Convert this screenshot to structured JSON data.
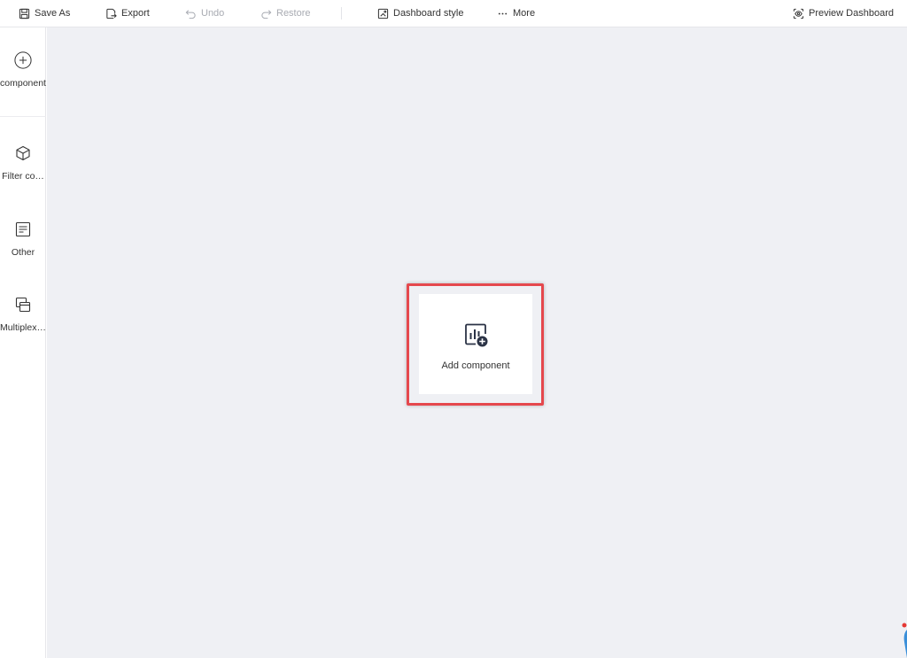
{
  "toolbar": {
    "save_as": "Save As",
    "export": "Export",
    "undo": "Undo",
    "restore": "Restore",
    "dashboard_style": "Dashboard style",
    "more": "More",
    "preview": "Preview Dashboard"
  },
  "sidebar": {
    "items": [
      {
        "label": "component",
        "icon": "plus-circle-icon"
      },
      {
        "label": "Filter co…",
        "icon": "cube-icon"
      },
      {
        "label": "Other",
        "icon": "text-box-icon"
      },
      {
        "label": "Multiplex…",
        "icon": "stacked-windows-icon"
      }
    ]
  },
  "canvas": {
    "add_component_label": "Add component",
    "highlight_color": "#e5484d",
    "background": "#eff0f4"
  }
}
